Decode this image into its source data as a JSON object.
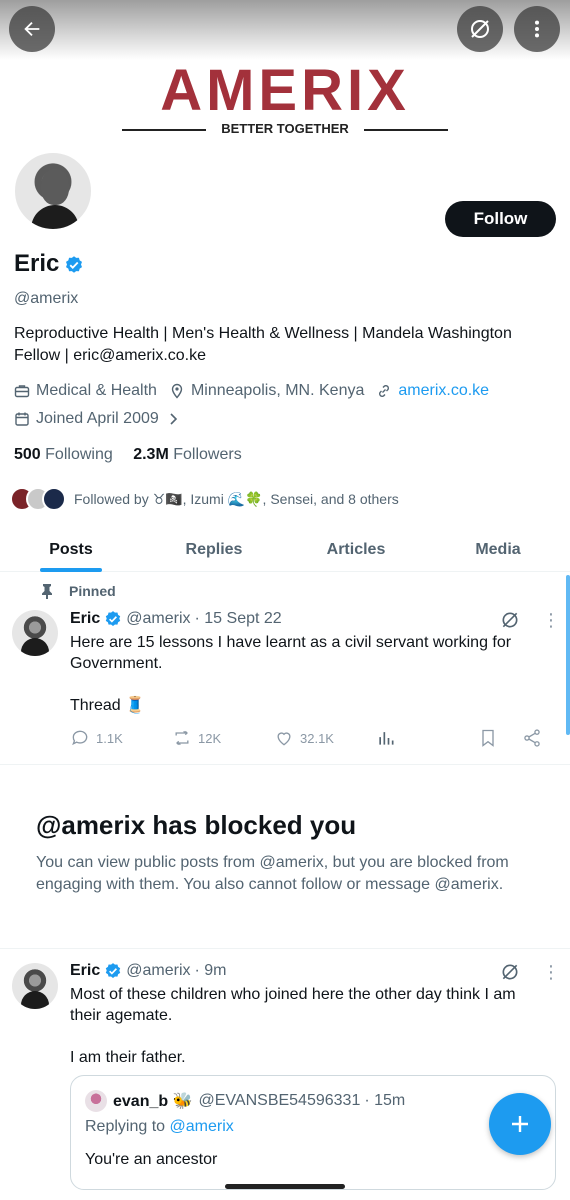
{
  "banner": {
    "brand_name": "AMERIX",
    "brand_tagline": "BETTER TOGETHER"
  },
  "profile": {
    "name": "Eric",
    "handle": "@amerix",
    "bio": "Reproductive Health | Men's Health & Wellness | Mandela Washington Fellow | eric@amerix.co.ke",
    "category": "Medical & Health",
    "location": "Minneapolis, MN. Kenya",
    "website": "amerix.co.ke",
    "joined": "Joined April 2009",
    "following_count": "500",
    "following_label": "Following",
    "followers_count": "2.3M",
    "followers_label": "Followers",
    "followed_by": "Followed by ♉🏴‍☠️, Izumi 🌊🍀, Sensei, and 8 others",
    "follow_label": "Follow"
  },
  "tabs": [
    "Posts",
    "Replies",
    "Articles",
    "Media"
  ],
  "pinned_post": {
    "pinned_label": "Pinned",
    "author": "Eric",
    "handle": "@amerix",
    "time": "· 15 Sept 22",
    "text_line1": "Here are 15 lessons I have learnt as a civil servant working for Government.",
    "text_line2": "Thread 🧵",
    "replies": "1.1K",
    "reposts": "12K",
    "likes": "32.1K"
  },
  "blocked": {
    "title": "@amerix has blocked you",
    "text": "You can view public posts from @amerix, but you are blocked from engaging with them. You also cannot follow or message @amerix."
  },
  "second_post": {
    "author": "Eric",
    "handle": "@amerix",
    "time": "· 9m",
    "text_line1": "Most of these children who joined here the other day think I am their agemate.",
    "text_line2": "I am their father.",
    "quote": {
      "author": "evan_b 🐝",
      "handle": "@EVANSBE54596331",
      "time": "· 15m",
      "replying_prefix": "Replying to",
      "replying_handle": "@amerix",
      "text": "You're an ancestor"
    }
  },
  "colors": {
    "accent": "#1d9bf0",
    "brand": "#a3313b",
    "text": "#0f1419",
    "muted": "#536471"
  }
}
